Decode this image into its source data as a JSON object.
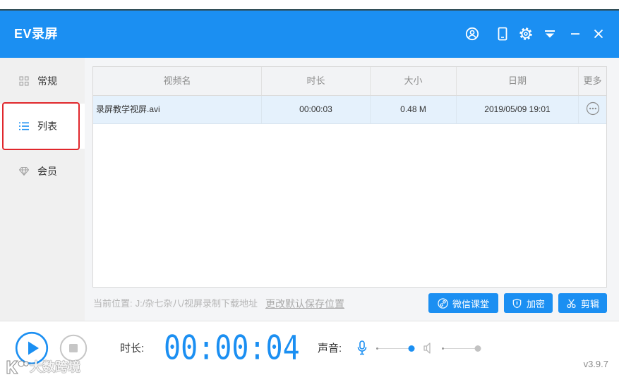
{
  "window": {
    "title": "EV录屏",
    "controls": [
      "user-circle-icon",
      "tablet-icon",
      "gear-icon",
      "dropdown-menu-icon",
      "minimize-icon",
      "close-icon"
    ]
  },
  "colors": {
    "accent": "#1b8ff2",
    "annotation": "#e0272c",
    "row_selected": "#e5f1fc"
  },
  "sidebar": {
    "items": [
      {
        "label": "常规",
        "icon": "grid-icon",
        "selected": false
      },
      {
        "label": "列表",
        "icon": "list-icon",
        "selected": true
      },
      {
        "label": "会员",
        "icon": "diamond-icon",
        "selected": false
      }
    ]
  },
  "table": {
    "columns": [
      "视频名",
      "时长",
      "大小",
      "日期",
      "更多"
    ],
    "rows": [
      {
        "name": "录屏教学视屏.avi",
        "duration": "00:00:03",
        "size": "0.48 M",
        "date": "2019/05/09 19:01",
        "more_icon": "more-dots-icon",
        "selected": true
      }
    ]
  },
  "save_location": {
    "label": "当前位置:",
    "path": "J:/杂七杂八/视屏录制下载地址",
    "change_link": "更改默认保存位置"
  },
  "actions": [
    {
      "label": "微信课堂",
      "icon": "link-circle-icon"
    },
    {
      "label": "加密",
      "icon": "shield-icon"
    },
    {
      "label": "剪辑",
      "icon": "scissors-icon"
    }
  ],
  "recorder": {
    "play_icon": "play-icon",
    "stop_icon": "stop-icon",
    "duration_label": "时长:",
    "elapsed": "00:00:04",
    "audio_label": "声音:",
    "mic_icon": "microphone-icon",
    "mic_enabled": true,
    "mic_level": 1.0,
    "speaker_icon": "speaker-icon",
    "speaker_enabled": false,
    "speaker_level": 1.0
  },
  "version": "v3.9.7",
  "watermark": {
    "text": "大数跨境",
    "logo_icon": "watermark-logo-icon"
  }
}
